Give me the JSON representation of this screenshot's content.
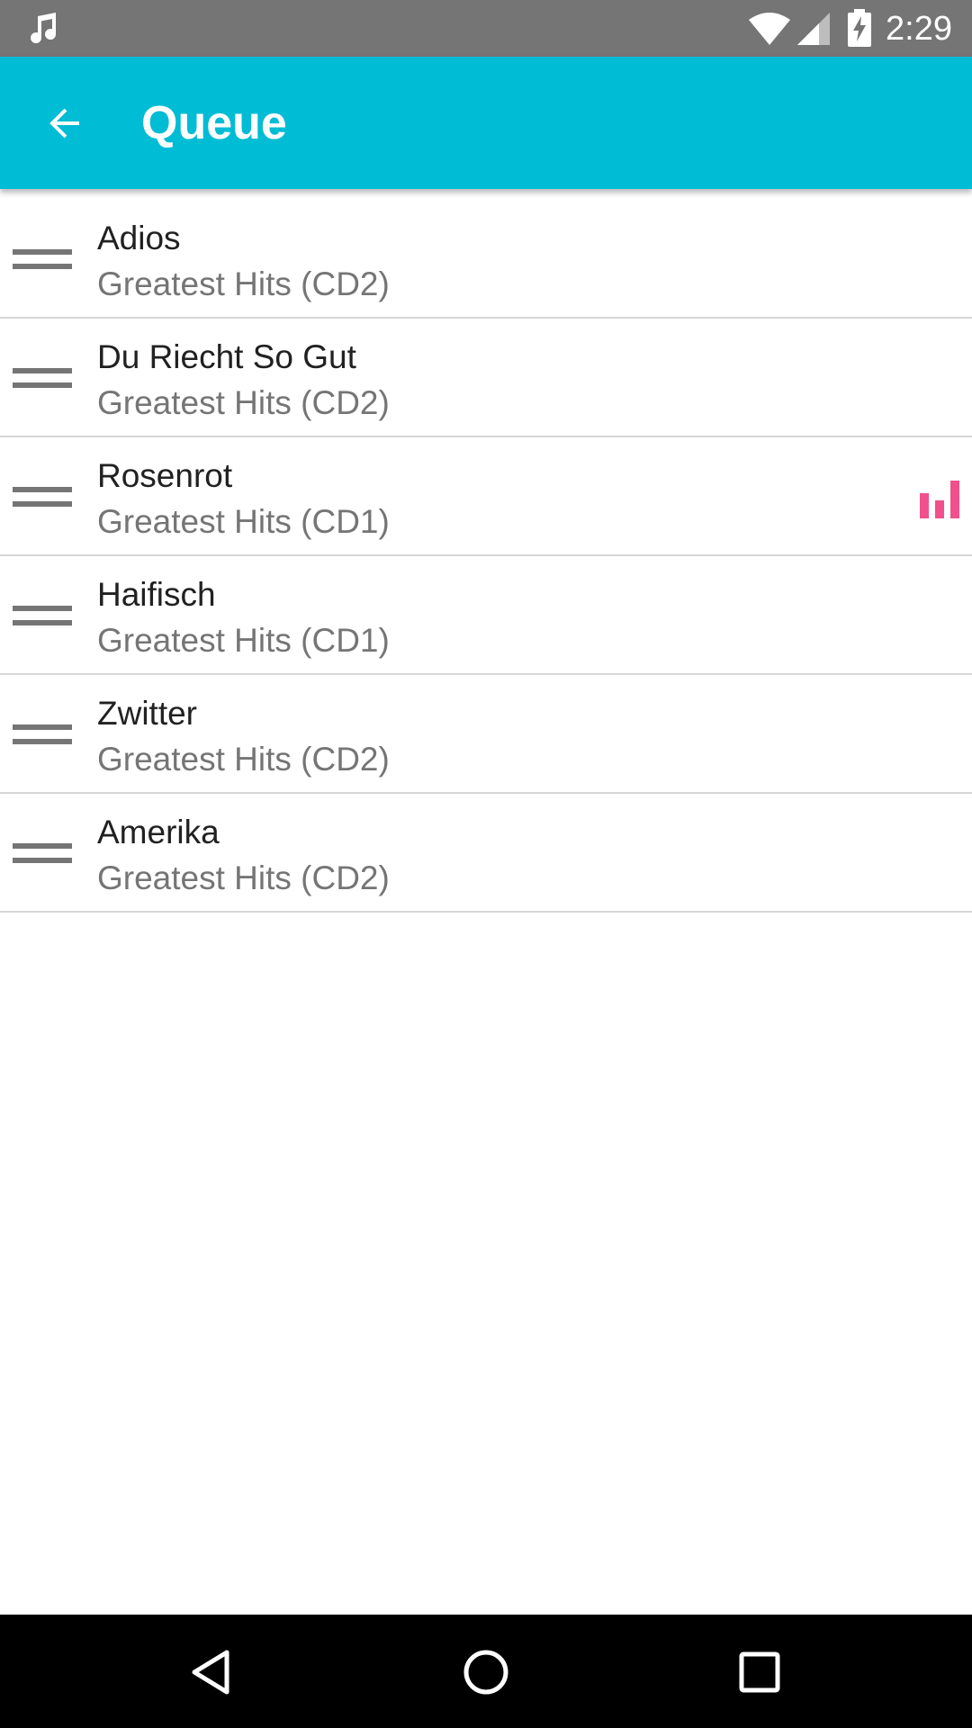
{
  "status_bar": {
    "time": "2:29",
    "icons": [
      "music-note-icon",
      "wifi-icon",
      "cell-signal-icon",
      "battery-charging-icon"
    ]
  },
  "app_bar": {
    "title": "Queue",
    "back_icon": "arrow-back-icon"
  },
  "queue": {
    "items": [
      {
        "title": "Adios",
        "album": "Greatest Hits (CD2)",
        "now_playing": false
      },
      {
        "title": "Du Riecht So Gut",
        "album": "Greatest Hits (CD2)",
        "now_playing": false
      },
      {
        "title": "Rosenrot",
        "album": "Greatest Hits (CD1)",
        "now_playing": true
      },
      {
        "title": "Haifisch",
        "album": "Greatest Hits (CD1)",
        "now_playing": false
      },
      {
        "title": "Zwitter",
        "album": "Greatest Hits (CD2)",
        "now_playing": false
      },
      {
        "title": "Amerika",
        "album": "Greatest Hits (CD2)",
        "now_playing": false
      }
    ]
  },
  "nav_bar": {
    "icons": [
      "nav-back-icon",
      "nav-home-icon",
      "nav-recents-icon"
    ]
  },
  "colors": {
    "status_bar": "#757575",
    "app_bar": "#00bcd4",
    "now_playing_accent": "#f0508c",
    "primary_text": "#212121",
    "secondary_text": "#757575",
    "divider": "#d6d6d6",
    "nav_bar": "#000000"
  }
}
